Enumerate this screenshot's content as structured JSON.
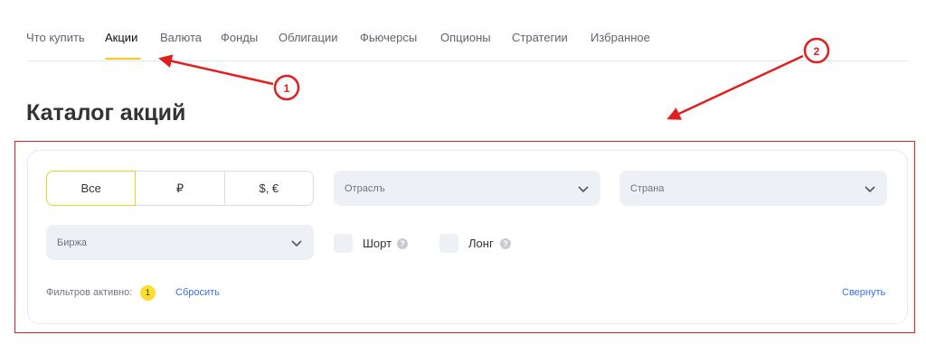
{
  "tabs": [
    {
      "label": "Что купить"
    },
    {
      "label": "Акции"
    },
    {
      "label": "Валюта"
    },
    {
      "label": "Фонды"
    },
    {
      "label": "Облигации"
    },
    {
      "label": "Фьючерсы"
    },
    {
      "label": "Опционы"
    },
    {
      "label": "Стратегии"
    },
    {
      "label": "Избранное"
    }
  ],
  "active_tab": "Акции",
  "page_title": "Каталог акций",
  "filters": {
    "currency_segments": [
      "Все",
      "₽",
      "$, €"
    ],
    "selected_currency": "Все",
    "industry_placeholder": "Отраслъ",
    "country_placeholder": "Страна",
    "exchange_placeholder": "Биржа",
    "short_label": "Шорт",
    "long_label": "Лонг",
    "active_label": "Фильтров активно:",
    "active_count": "1",
    "reset_label": "Сбросить",
    "collapse_label": "Свернуть"
  },
  "annotations": {
    "marker1": "1",
    "marker2": "2"
  },
  "colors": {
    "accent_yellow": "#f2cc25",
    "badge_yellow": "#ffdd2d",
    "link_blue": "#336fee",
    "annotation_red": "#e02020",
    "input_bg": "#edf0f5"
  }
}
